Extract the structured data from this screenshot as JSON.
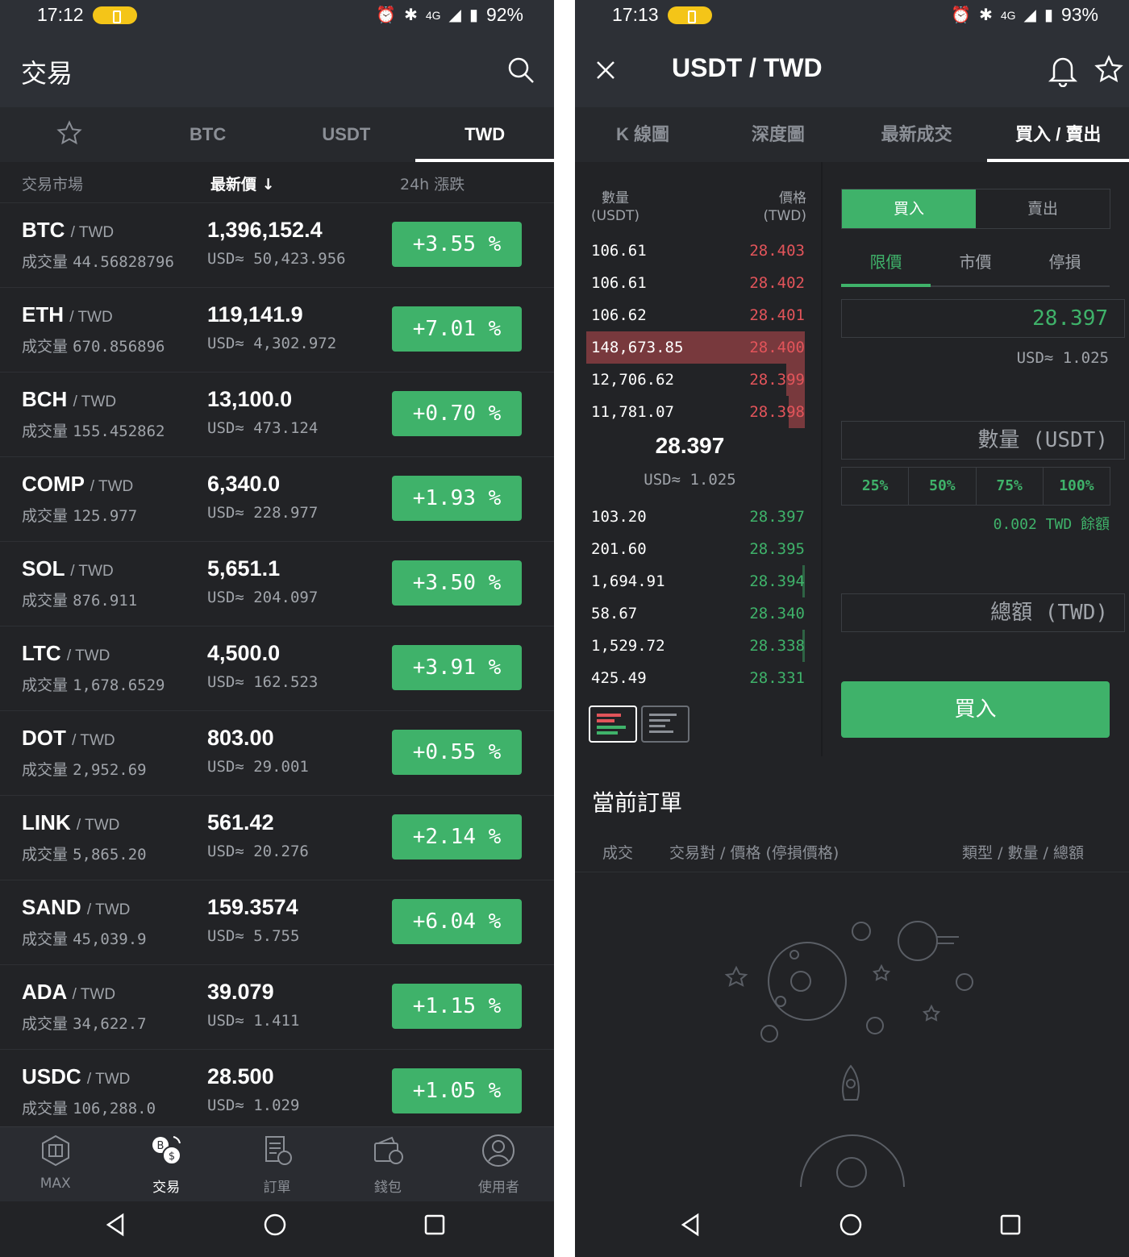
{
  "left": {
    "status": {
      "time": "17:12",
      "network": "4G",
      "battery": "92%"
    },
    "title": "交易",
    "tabs": [
      "BTC",
      "USDT",
      "TWD"
    ],
    "active_tab": "TWD",
    "columns": {
      "market": "交易市場",
      "price": "最新價 ↓",
      "change": "24h 漲跌"
    },
    "vol_label": "成交量",
    "markets": [
      {
        "base": "BTC",
        "quote": "/ TWD",
        "volume": "44.56828796",
        "price": "1,396,152.4",
        "usd": "USD≈ 50,423.956",
        "change": "+3.55 %"
      },
      {
        "base": "ETH",
        "quote": "/ TWD",
        "volume": "670.856896",
        "price": "119,141.9",
        "usd": "USD≈ 4,302.972",
        "change": "+7.01 %"
      },
      {
        "base": "BCH",
        "quote": "/ TWD",
        "volume": "155.452862",
        "price": "13,100.0",
        "usd": "USD≈ 473.124",
        "change": "+0.70 %"
      },
      {
        "base": "COMP",
        "quote": "/ TWD",
        "volume": "125.977",
        "price": "6,340.0",
        "usd": "USD≈ 228.977",
        "change": "+1.93 %"
      },
      {
        "base": "SOL",
        "quote": "/ TWD",
        "volume": "876.911",
        "price": "5,651.1",
        "usd": "USD≈ 204.097",
        "change": "+3.50 %"
      },
      {
        "base": "LTC",
        "quote": "/ TWD",
        "volume": "1,678.6529",
        "price": "4,500.0",
        "usd": "USD≈ 162.523",
        "change": "+3.91 %"
      },
      {
        "base": "DOT",
        "quote": "/ TWD",
        "volume": "2,952.69",
        "price": "803.00",
        "usd": "USD≈ 29.001",
        "change": "+0.55 %"
      },
      {
        "base": "LINK",
        "quote": "/ TWD",
        "volume": "5,865.20",
        "price": "561.42",
        "usd": "USD≈ 20.276",
        "change": "+2.14 %"
      },
      {
        "base": "SAND",
        "quote": "/ TWD",
        "volume": "45,039.9",
        "price": "159.3574",
        "usd": "USD≈ 5.755",
        "change": "+6.04 %"
      },
      {
        "base": "ADA",
        "quote": "/ TWD",
        "volume": "34,622.7",
        "price": "39.079",
        "usd": "USD≈ 1.411",
        "change": "+1.15 %"
      },
      {
        "base": "USDC",
        "quote": "/ TWD",
        "volume": "106,288.0",
        "price": "28.500",
        "usd": "USD≈ 1.029",
        "change": "+1.05 %"
      }
    ],
    "nav": [
      {
        "label": "MAX",
        "icon": "max-icon"
      },
      {
        "label": "交易",
        "icon": "exchange-icon"
      },
      {
        "label": "訂單",
        "icon": "orders-icon"
      },
      {
        "label": "錢包",
        "icon": "wallet-icon"
      },
      {
        "label": "使用者",
        "icon": "user-icon"
      }
    ]
  },
  "right": {
    "status": {
      "time": "17:13",
      "network": "4G",
      "battery": "93%"
    },
    "pair": "USDT / TWD",
    "tabs": [
      "K 線圖",
      "深度圖",
      "最新成交",
      "買入 / 賣出"
    ],
    "active_tab": "買入 / 賣出",
    "orderbook": {
      "qty_head": "數量\n(USDT)",
      "price_head": "價格\n(TWD)",
      "asks": [
        {
          "qty": "106.61",
          "price": "28.403",
          "depth": 0
        },
        {
          "qty": "106.61",
          "price": "28.402",
          "depth": 0
        },
        {
          "qty": "106.62",
          "price": "28.401",
          "depth": 0
        },
        {
          "qty": "148,673.85",
          "price": "28.400",
          "depth": 0.95
        },
        {
          "qty": "12,706.62",
          "price": "28.399",
          "depth": 0.08
        },
        {
          "qty": "11,781.07",
          "price": "28.398",
          "depth": 0.07
        }
      ],
      "last_price": "28.397",
      "last_usd": "USD≈ 1.025",
      "bids": [
        {
          "qty": "103.20",
          "price": "28.397",
          "depth": 0
        },
        {
          "qty": "201.60",
          "price": "28.395",
          "depth": 0
        },
        {
          "qty": "1,694.91",
          "price": "28.394",
          "depth": 0.01
        },
        {
          "qty": "58.67",
          "price": "28.340",
          "depth": 0
        },
        {
          "qty": "1,529.72",
          "price": "28.338",
          "depth": 0.01
        },
        {
          "qty": "425.49",
          "price": "28.331",
          "depth": 0
        }
      ]
    },
    "form": {
      "side_buy": "買入",
      "side_sell": "賣出",
      "order_types": [
        "限價",
        "市價",
        "停損"
      ],
      "price_value": "28.397",
      "price_usd": "USD≈ 1.025",
      "qty_placeholder": "數量 (USDT)",
      "percents": [
        "25%",
        "50%",
        "75%",
        "100%"
      ],
      "balance": "0.002 TWD 餘額",
      "total_placeholder": "總額 (TWD)",
      "submit": "買入"
    },
    "orders": {
      "title": "當前訂單",
      "col_fill": "成交",
      "col_pair": "交易對 / 價格 (停損價格)",
      "col_type": "類型 / 數量 / 總額"
    },
    "colors": {
      "up": "#3fb26a",
      "down": "#e2545a",
      "bg": "#222326"
    }
  }
}
